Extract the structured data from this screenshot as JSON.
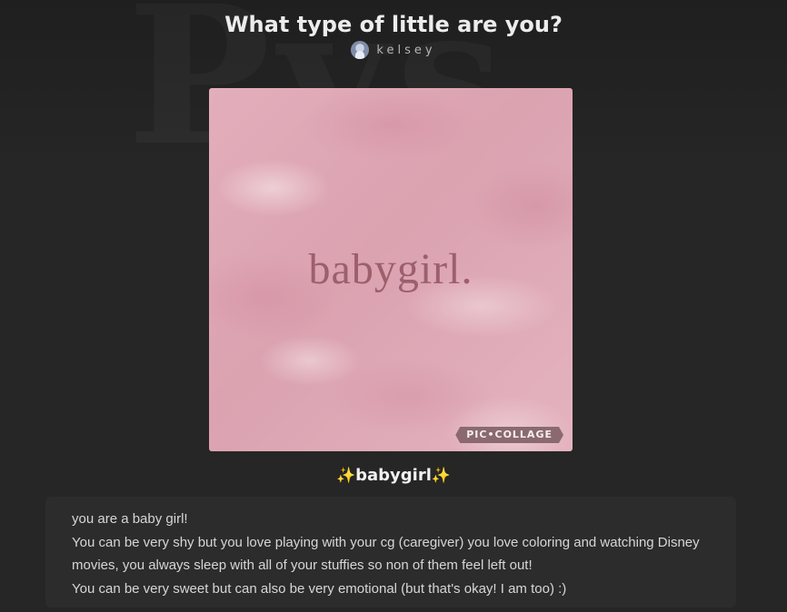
{
  "quiz": {
    "title": "What type of little are you?",
    "author": "kelsey"
  },
  "result": {
    "image_text": "babygirl.",
    "watermark": "PIC•COLLAGE",
    "sparkle_left": "✨",
    "name": "babygirl",
    "sparkle_right": "✨",
    "description": [
      "you are a baby girl!",
      "You can be very shy but you love playing with your cg (caregiver) you love coloring and watching Disney",
      "movies, you always sleep with all of your stuffies so non of them feel left out!",
      "You can be very sweet but can also be very emotional (but that's okay! I am too) :)"
    ]
  },
  "colors": {
    "background": "#262626",
    "card": "#2c2c2c",
    "image_text": "#9d5f6c",
    "image_pink": "#dba2b0"
  }
}
